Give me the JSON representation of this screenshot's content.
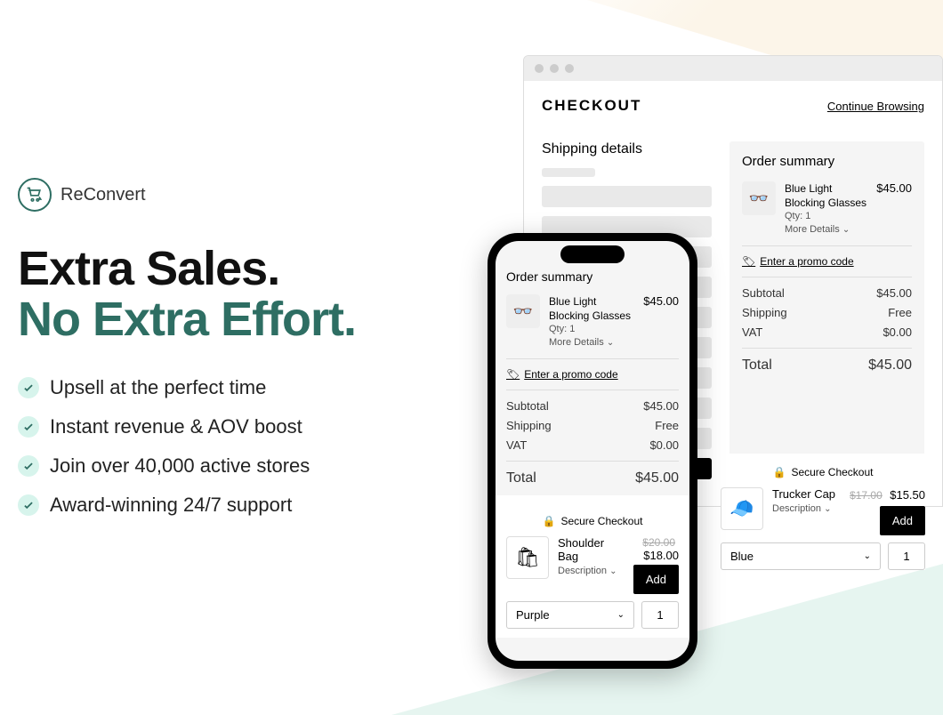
{
  "brand": {
    "name": "ReConvert"
  },
  "headline": {
    "line1": "Extra Sales.",
    "line2": "No Extra Effort."
  },
  "bullets": [
    "Upsell at the perfect time",
    "Instant revenue & AOV boost",
    "Join over 40,000 active stores",
    "Award-winning 24/7 support"
  ],
  "browser": {
    "title": "CHECKOUT",
    "continue": "Continue Browsing",
    "shipping_title": "Shipping details",
    "summary_title": "Order summary",
    "item": {
      "name": "Blue Light Blocking Glasses",
      "qty_label": "Qty: 1",
      "more": "More Details",
      "price": "$45.00"
    },
    "promo": "Enter a promo code",
    "subtotal_label": "Subtotal",
    "subtotal": "$45.00",
    "shipping_label": "Shipping",
    "shipping_value": "Free",
    "vat_label": "VAT",
    "vat": "$0.00",
    "total_label": "Total",
    "total": "$45.00",
    "secure": "Secure Checkout"
  },
  "upsell_desktop": {
    "name": "Trucker Cap",
    "old_price": "$17.00",
    "new_price": "$15.50",
    "desc": "Description",
    "add": "Add",
    "variant": "Blue",
    "qty": "1"
  },
  "phone": {
    "summary_title": "Order summary",
    "item": {
      "name": "Blue Light Blocking Glasses",
      "qty_label": "Qty: 1",
      "more": "More Details",
      "price": "$45.00"
    },
    "promo": "Enter a promo code",
    "subtotal_label": "Subtotal",
    "subtotal": "$45.00",
    "shipping_label": "Shipping",
    "shipping_value": "Free",
    "vat_label": "VAT",
    "vat": "$0.00",
    "total_label": "Total",
    "total": "$45.00",
    "secure": "Secure Checkout",
    "upsell": {
      "name": "Shoulder Bag",
      "old_price": "$20.00",
      "new_price": "$18.00",
      "desc": "Description",
      "add": "Add",
      "variant": "Purple",
      "qty": "1"
    }
  }
}
